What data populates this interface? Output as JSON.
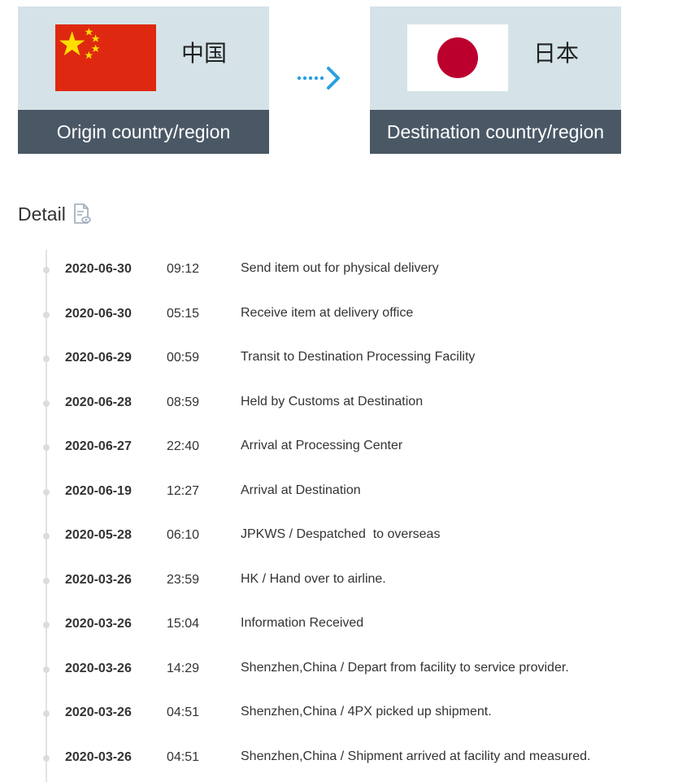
{
  "origin": {
    "name": "中国",
    "label": "Origin country/region",
    "flag_icon": "china-flag-icon"
  },
  "destination": {
    "name": "日本",
    "label": "Destination country/region",
    "flag_icon": "japan-flag-icon"
  },
  "arrow_icon": "dotted-right-arrow-icon",
  "detail": {
    "title": "Detail",
    "icon": "document-view-icon"
  },
  "colors": {
    "card_bg": "#d5e3e8",
    "card_footer": "#4a5866",
    "arrow": "#2a9fe2",
    "china_red": "#de2910",
    "china_star": "#ffde00",
    "japan_red": "#bc002d"
  },
  "events": [
    {
      "date": "2020-06-30",
      "time": "09:12",
      "desc": "Send item out for physical delivery"
    },
    {
      "date": "2020-06-30",
      "time": "05:15",
      "desc": "Receive item at delivery office"
    },
    {
      "date": "2020-06-29",
      "time": "00:59",
      "desc": "Transit to Destination Processing Facility"
    },
    {
      "date": "2020-06-28",
      "time": "08:59",
      "desc": "Held by Customs at Destination"
    },
    {
      "date": "2020-06-27",
      "time": "22:40",
      "desc": "Arrival at Processing Center"
    },
    {
      "date": "2020-06-19",
      "time": "12:27",
      "desc": "Arrival at Destination"
    },
    {
      "date": "2020-05-28",
      "time": "06:10",
      "desc": "JPKWS / Despatched  to overseas"
    },
    {
      "date": "2020-03-26",
      "time": "23:59",
      "desc": "HK / Hand over to airline."
    },
    {
      "date": "2020-03-26",
      "time": "15:04",
      "desc": "Information Received"
    },
    {
      "date": "2020-03-26",
      "time": "14:29",
      "desc": "Shenzhen,China / Depart from facility to service provider."
    },
    {
      "date": "2020-03-26",
      "time": "04:51",
      "desc": "Shenzhen,China / 4PX picked up shipment."
    },
    {
      "date": "2020-03-26",
      "time": "04:51",
      "desc": "Shenzhen,China / Shipment arrived at facility and measured."
    }
  ]
}
